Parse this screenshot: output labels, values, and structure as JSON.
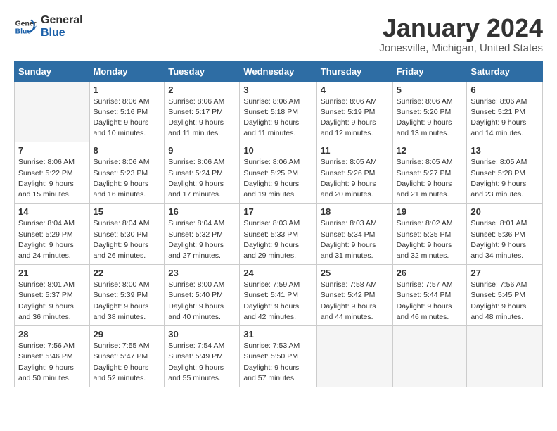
{
  "logo": {
    "text_general": "General",
    "text_blue": "Blue"
  },
  "header": {
    "month": "January 2024",
    "location": "Jonesville, Michigan, United States"
  },
  "weekdays": [
    "Sunday",
    "Monday",
    "Tuesday",
    "Wednesday",
    "Thursday",
    "Friday",
    "Saturday"
  ],
  "weeks": [
    [
      {
        "day": "",
        "empty": true
      },
      {
        "day": "1",
        "sunrise": "8:06 AM",
        "sunset": "5:16 PM",
        "daylight": "9 hours and 10 minutes."
      },
      {
        "day": "2",
        "sunrise": "8:06 AM",
        "sunset": "5:17 PM",
        "daylight": "9 hours and 11 minutes."
      },
      {
        "day": "3",
        "sunrise": "8:06 AM",
        "sunset": "5:18 PM",
        "daylight": "9 hours and 11 minutes."
      },
      {
        "day": "4",
        "sunrise": "8:06 AM",
        "sunset": "5:19 PM",
        "daylight": "9 hours and 12 minutes."
      },
      {
        "day": "5",
        "sunrise": "8:06 AM",
        "sunset": "5:20 PM",
        "daylight": "9 hours and 13 minutes."
      },
      {
        "day": "6",
        "sunrise": "8:06 AM",
        "sunset": "5:21 PM",
        "daylight": "9 hours and 14 minutes."
      }
    ],
    [
      {
        "day": "7",
        "sunrise": "8:06 AM",
        "sunset": "5:22 PM",
        "daylight": "9 hours and 15 minutes."
      },
      {
        "day": "8",
        "sunrise": "8:06 AM",
        "sunset": "5:23 PM",
        "daylight": "9 hours and 16 minutes."
      },
      {
        "day": "9",
        "sunrise": "8:06 AM",
        "sunset": "5:24 PM",
        "daylight": "9 hours and 17 minutes."
      },
      {
        "day": "10",
        "sunrise": "8:06 AM",
        "sunset": "5:25 PM",
        "daylight": "9 hours and 19 minutes."
      },
      {
        "day": "11",
        "sunrise": "8:05 AM",
        "sunset": "5:26 PM",
        "daylight": "9 hours and 20 minutes."
      },
      {
        "day": "12",
        "sunrise": "8:05 AM",
        "sunset": "5:27 PM",
        "daylight": "9 hours and 21 minutes."
      },
      {
        "day": "13",
        "sunrise": "8:05 AM",
        "sunset": "5:28 PM",
        "daylight": "9 hours and 23 minutes."
      }
    ],
    [
      {
        "day": "14",
        "sunrise": "8:04 AM",
        "sunset": "5:29 PM",
        "daylight": "9 hours and 24 minutes."
      },
      {
        "day": "15",
        "sunrise": "8:04 AM",
        "sunset": "5:30 PM",
        "daylight": "9 hours and 26 minutes."
      },
      {
        "day": "16",
        "sunrise": "8:04 AM",
        "sunset": "5:32 PM",
        "daylight": "9 hours and 27 minutes."
      },
      {
        "day": "17",
        "sunrise": "8:03 AM",
        "sunset": "5:33 PM",
        "daylight": "9 hours and 29 minutes."
      },
      {
        "day": "18",
        "sunrise": "8:03 AM",
        "sunset": "5:34 PM",
        "daylight": "9 hours and 31 minutes."
      },
      {
        "day": "19",
        "sunrise": "8:02 AM",
        "sunset": "5:35 PM",
        "daylight": "9 hours and 32 minutes."
      },
      {
        "day": "20",
        "sunrise": "8:01 AM",
        "sunset": "5:36 PM",
        "daylight": "9 hours and 34 minutes."
      }
    ],
    [
      {
        "day": "21",
        "sunrise": "8:01 AM",
        "sunset": "5:37 PM",
        "daylight": "9 hours and 36 minutes."
      },
      {
        "day": "22",
        "sunrise": "8:00 AM",
        "sunset": "5:39 PM",
        "daylight": "9 hours and 38 minutes."
      },
      {
        "day": "23",
        "sunrise": "8:00 AM",
        "sunset": "5:40 PM",
        "daylight": "9 hours and 40 minutes."
      },
      {
        "day": "24",
        "sunrise": "7:59 AM",
        "sunset": "5:41 PM",
        "daylight": "9 hours and 42 minutes."
      },
      {
        "day": "25",
        "sunrise": "7:58 AM",
        "sunset": "5:42 PM",
        "daylight": "9 hours and 44 minutes."
      },
      {
        "day": "26",
        "sunrise": "7:57 AM",
        "sunset": "5:44 PM",
        "daylight": "9 hours and 46 minutes."
      },
      {
        "day": "27",
        "sunrise": "7:56 AM",
        "sunset": "5:45 PM",
        "daylight": "9 hours and 48 minutes."
      }
    ],
    [
      {
        "day": "28",
        "sunrise": "7:56 AM",
        "sunset": "5:46 PM",
        "daylight": "9 hours and 50 minutes."
      },
      {
        "day": "29",
        "sunrise": "7:55 AM",
        "sunset": "5:47 PM",
        "daylight": "9 hours and 52 minutes."
      },
      {
        "day": "30",
        "sunrise": "7:54 AM",
        "sunset": "5:49 PM",
        "daylight": "9 hours and 55 minutes."
      },
      {
        "day": "31",
        "sunrise": "7:53 AM",
        "sunset": "5:50 PM",
        "daylight": "9 hours and 57 minutes."
      },
      {
        "day": "",
        "empty": true
      },
      {
        "day": "",
        "empty": true
      },
      {
        "day": "",
        "empty": true
      }
    ]
  ],
  "labels": {
    "sunrise": "Sunrise: ",
    "sunset": "Sunset: ",
    "daylight": "Daylight: "
  }
}
